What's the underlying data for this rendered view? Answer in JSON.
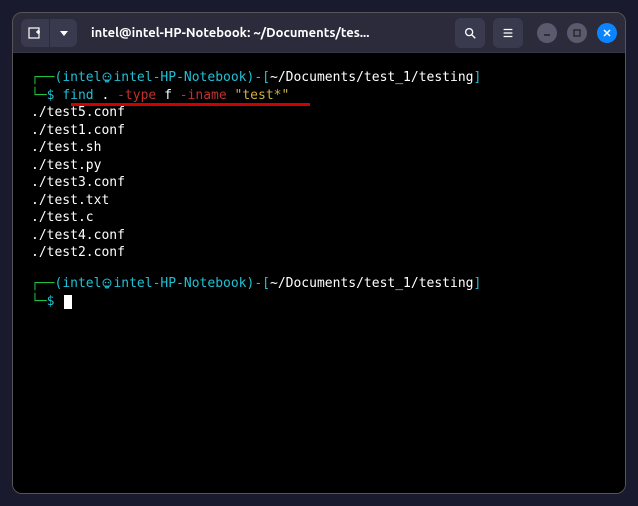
{
  "titlebar": {
    "title": "intel@intel-HP-Notebook: ~/Documents/tes..."
  },
  "prompt1": {
    "paren_open": "(",
    "user": "intel",
    "at_host": "intel-HP-Notebook",
    "paren_close": ")",
    "dash": "-",
    "bracket_open": "[",
    "path": "~/Documents/test_1/testing",
    "bracket_close": "]",
    "dollar": "$ ",
    "cmd_find": "find",
    "cmd_space1": " ",
    "cmd_dot": ".",
    "cmd_space2": " ",
    "cmd_type": "-type",
    "cmd_space3": " ",
    "cmd_f": "f",
    "cmd_space4": " ",
    "cmd_iname": "-iname",
    "cmd_space5": " ",
    "cmd_pattern": "\"test*\""
  },
  "output": [
    "./test5.conf",
    "./test1.conf",
    "./test.sh",
    "./test.py",
    "./test3.conf",
    "./test.txt",
    "./test.c",
    "./test4.conf",
    "./test2.conf"
  ],
  "prompt2": {
    "paren_open": "(",
    "user": "intel",
    "at_host": "intel-HP-Notebook",
    "paren_close": ")",
    "dash": "-",
    "bracket_open": "[",
    "path": "~/Documents/test_1/testing",
    "bracket_close": "]",
    "dollar": "$ "
  },
  "tree": {
    "top": "┌──",
    "bottom": "└─"
  }
}
